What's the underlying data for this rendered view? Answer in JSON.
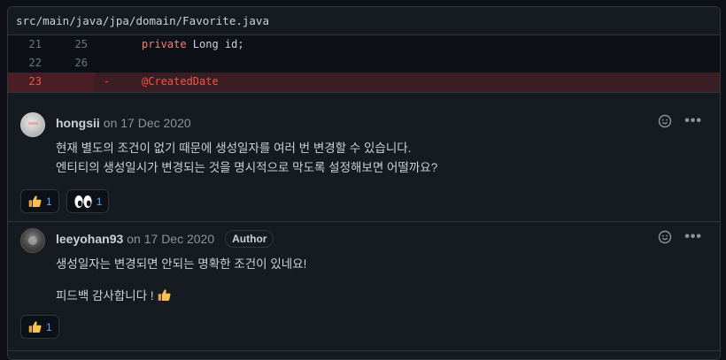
{
  "file": {
    "path": "src/main/java/jpa/domain/Favorite.java"
  },
  "code_lines": [
    {
      "old": "21",
      "new": "25",
      "marker": "",
      "keyword": "private",
      "rest": " Long id;",
      "deleted": false
    },
    {
      "old": "22",
      "new": "26",
      "marker": "",
      "keyword": "",
      "rest": "",
      "deleted": false
    },
    {
      "old": "23",
      "new": "",
      "marker": "-",
      "keyword": "",
      "rest": "@CreatedDate",
      "deleted": true
    }
  ],
  "comments": [
    {
      "author": "hongsii",
      "date": "on 17 Dec 2020",
      "badge": "",
      "body": [
        "현재 별도의 조건이 없기 때문에 생성일자를 여러 번 변경할 수 있습니다.",
        "엔티티의 생성일시가 변경되는 것을 명시적으로 막도록 설정해보면 어떨까요?"
      ],
      "reactions": [
        {
          "icon": "thumbs-up-icon",
          "count": "1"
        },
        {
          "icon": "eyes-icon",
          "count": "1"
        }
      ]
    },
    {
      "author": "leeyohan93",
      "date": "on 17 Dec 2020",
      "badge": "Author",
      "body": [
        "생성일자는 변경되면 안되는 명확한 조건이 있네요!",
        "피드백 감사합니다 !"
      ],
      "reactions": [
        {
          "icon": "thumbs-up-icon",
          "count": "1"
        }
      ]
    }
  ],
  "colors": {
    "background": "#0d1117",
    "panel": "#161b22",
    "border": "#30363d",
    "deleted_line": "#f85149",
    "keyword": "#ff7b72",
    "link": "#58a6ff",
    "muted": "#8b949e"
  }
}
